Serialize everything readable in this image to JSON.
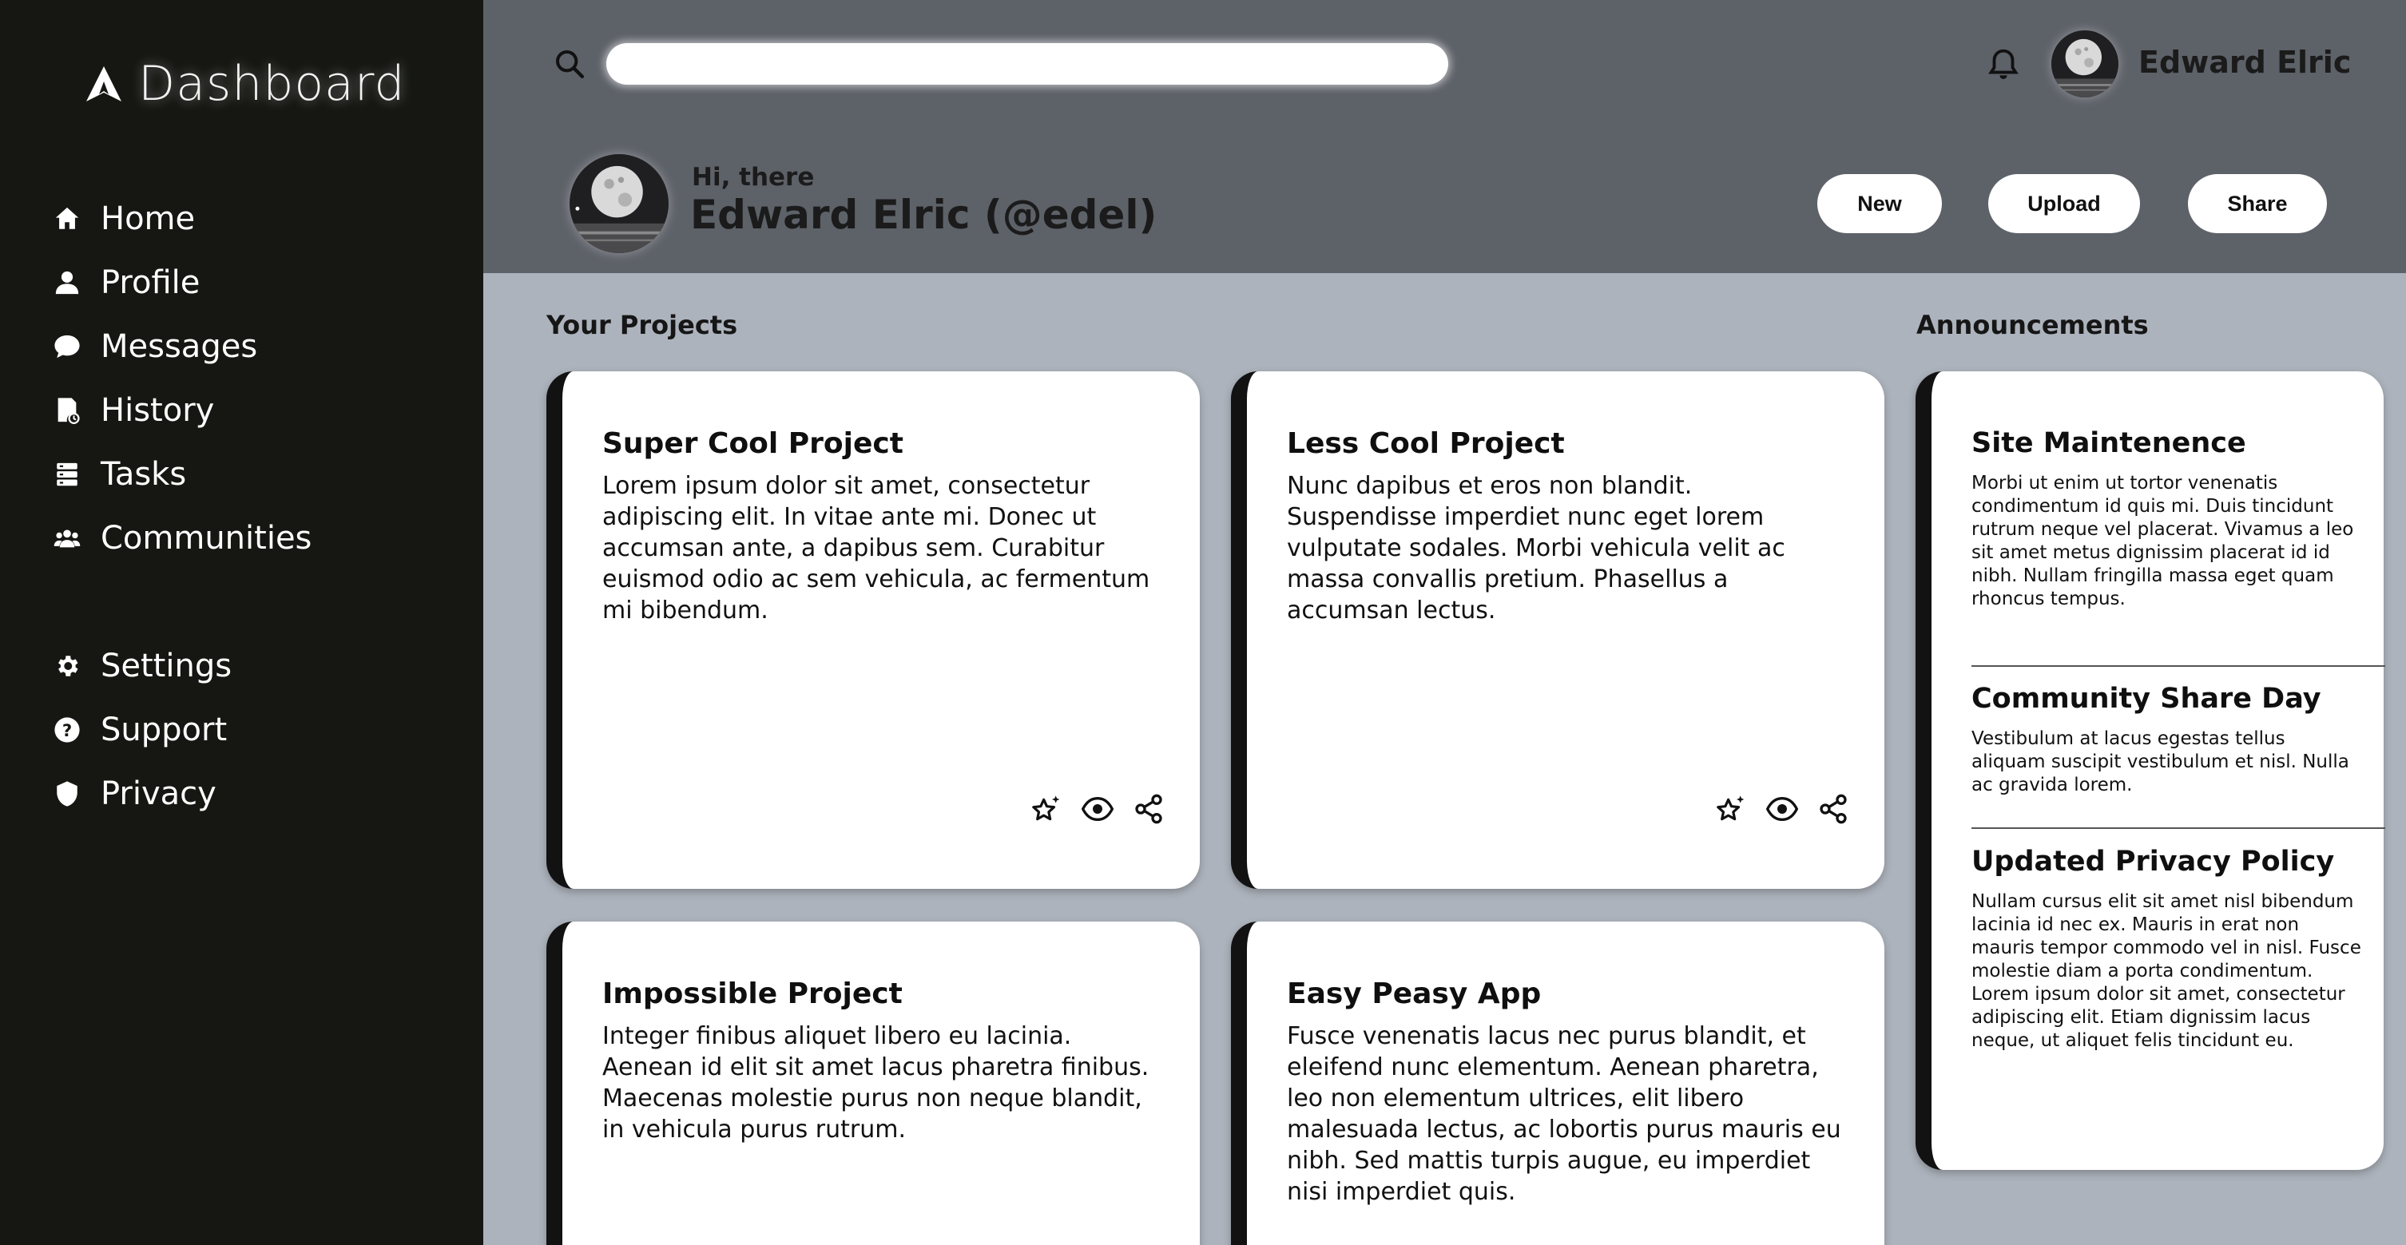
{
  "sidebar": {
    "brand": "Dashboard",
    "main_items": [
      {
        "label": "Home",
        "icon": "home-icon"
      },
      {
        "label": "Profile",
        "icon": "user-icon"
      },
      {
        "label": "Messages",
        "icon": "chat-bubble-icon"
      },
      {
        "label": "History",
        "icon": "history-document-icon"
      },
      {
        "label": "Tasks",
        "icon": "tasks-icon"
      },
      {
        "label": "Communities",
        "icon": "community-icon"
      }
    ],
    "secondary_items": [
      {
        "label": "Settings",
        "icon": "gear-icon"
      },
      {
        "label": "Support",
        "icon": "help-icon"
      },
      {
        "label": "Privacy",
        "icon": "shield-icon"
      }
    ]
  },
  "header": {
    "search": {
      "placeholder": "",
      "value": ""
    },
    "user_name": "Edward Elric",
    "greeting": "Hi, there",
    "full_name": "Edward Elric (@edel)",
    "buttons": {
      "new": "New",
      "upload": "Upload",
      "share": "Share"
    }
  },
  "projects": {
    "title": "Your Projects",
    "items": [
      {
        "title": "Super Cool Project",
        "body": "Lorem ipsum dolor sit amet, consectetur adipiscing elit. In vitae ante mi. Donec ut accumsan ante, a dapibus sem. Curabitur euismod odio ac sem vehicula, ac fermentum mi bibendum."
      },
      {
        "title": "Less Cool Project",
        "body": "Nunc dapibus et eros non blandit. Suspendisse imperdiet nunc eget lorem vulputate sodales. Morbi vehicula velit ac massa convallis pretium. Phasellus a accumsan lectus."
      },
      {
        "title": "Impossible Project",
        "body": "Integer finibus aliquet libero eu lacinia. Aenean id elit sit amet lacus pharetra finibus. Maecenas molestie purus non neque blandit, in vehicula purus rutrum."
      },
      {
        "title": "Easy Peasy App",
        "body": "Fusce venenatis lacus nec purus blandit, et eleifend nunc elementum. Aenean pharetra, leo non elementum ultrices, elit libero malesuada lectus, ac lobortis purus mauris eu nibh. Sed mattis turpis augue, eu imperdiet nisi imperdiet quis."
      }
    ]
  },
  "announcements": {
    "title": "Announcements",
    "items": [
      {
        "title": "Site Maintenence",
        "body": "Morbi ut enim ut tortor venenatis condimentum id quis mi. Duis tincidunt rutrum neque vel placerat. Vivamus a leo sit amet metus dignissim placerat id id nibh. Nullam fringilla massa eget quam rhoncus tempus."
      },
      {
        "title": "Community Share Day",
        "body": "Vestibulum at lacus egestas tellus aliquam suscipit vestibulum et nisl. Nulla ac gravida lorem."
      },
      {
        "title": "Updated Privacy Policy",
        "body": "Nullam cursus elit sit amet nisl bibendum lacinia id nec ex. Mauris in erat non mauris tempor commodo vel in nisl. Fusce molestie diam a porta condimentum. Lorem ipsum dolor sit amet, consectetur adipiscing elit. Etiam dignissim lacus neque, ut aliquet felis tincidunt eu."
      }
    ]
  },
  "colors": {
    "sidebar_bg": "#161713",
    "header_bg": "#5d6168",
    "content_bg": "#adb3bc",
    "card_bg": "#ffffff",
    "card_accent": "#121212"
  }
}
